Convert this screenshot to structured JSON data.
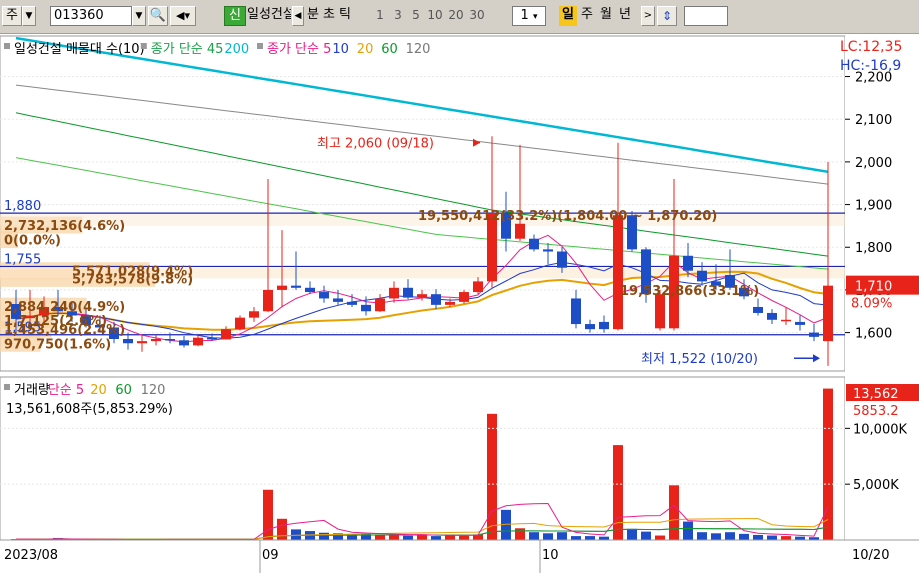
{
  "toolbar": {
    "market": "주",
    "code": "013360",
    "name_tab": "신",
    "name": "일성건설",
    "chart_types": [
      "분",
      "초",
      "틱"
    ],
    "intervals": [
      "1",
      "3",
      "5",
      "10",
      "20",
      "30"
    ],
    "interval_value": "1",
    "periods": [
      "일",
      "주",
      "월",
      "년"
    ],
    "active_period": "일"
  },
  "chart_data": [
    {
      "type": "candlestick",
      "title": "일성건설 매물대 수(10)",
      "legend": [
        {
          "text": "일성건설 매물대 수(10)",
          "color": "#000000"
        },
        {
          "text": "종가 단순 45",
          "color": "#1aa24a"
        },
        {
          "text": "200",
          "color": "#00b8d4"
        },
        {
          "text": "종가 단순 5",
          "color": "#e91e8c"
        },
        {
          "text": "10",
          "color": "#1e3cc8"
        },
        {
          "text": "20",
          "color": "#e6a100"
        },
        {
          "text": "60",
          "color": "#0a9a2a"
        },
        {
          "text": "120",
          "color": "#777777"
        }
      ],
      "y_ticks": [
        {
          "label": "2,200",
          "value": 2200
        },
        {
          "label": "2,100",
          "value": 2100
        },
        {
          "label": "2,000",
          "value": 2000
        },
        {
          "label": "1,900",
          "value": 1900
        },
        {
          "label": "1,800",
          "value": 1800
        },
        {
          "label": "1,700",
          "value": 1700
        },
        {
          "label": "1,600",
          "value": 1600
        }
      ],
      "ylim": [
        1510,
        2295
      ],
      "right_info": [
        "LC:12,35",
        "HC:-16,9"
      ],
      "last_price": {
        "label": "1,710",
        "value": 1710
      },
      "last_change": "8.09%",
      "annotations": {
        "high": "최고 2,060 (09/18)",
        "low": "최저 1,522 (10/20)",
        "range": "19,550,412(33.2%)(1,804.00 ~ 1,870.20)",
        "range2": "19,532,866(33.1%)"
      },
      "level_labels": [
        {
          "text": "1,880",
          "value": 1880,
          "color": "#1a3cc8"
        },
        {
          "text": "1,755",
          "value": 1755,
          "color": "#1a3cc8"
        },
        {
          "text": "1,595",
          "value": 1595,
          "color": "#1a3cc8"
        }
      ],
      "horizontal_lines": [
        1880,
        1755,
        1595
      ],
      "volume_profile": [
        {
          "label": "2,732,136(4.6%)",
          "price": 1852,
          "pct": 4.6
        },
        {
          "label": "0(0.0%)",
          "price": 1818,
          "pct": 0
        },
        {
          "label": "5,571,028(9.4%)",
          "price": 1745,
          "pct": 9.4
        },
        {
          "label": "5,783,578(9.8%)",
          "price": 1727,
          "pct": 9.8
        },
        {
          "label": "2,884,240(4.9%)",
          "price": 1662,
          "pct": 4.9
        },
        {
          "label": "1,7,125(2.6%)",
          "price": 1630,
          "pct": 2.6
        },
        {
          "label": "1,453,496(2.4%)",
          "price": 1608,
          "pct": 2.4
        },
        {
          "label": "970,750(1.6%)",
          "price": 1575,
          "pct": 1.6
        }
      ],
      "candles": [
        {
          "o": 1667,
          "h": 1700,
          "l": 1600,
          "c": 1632
        },
        {
          "o": 1634,
          "h": 1700,
          "l": 1605,
          "c": 1640
        },
        {
          "o": 1640,
          "h": 1685,
          "l": 1620,
          "c": 1660
        },
        {
          "o": 1660,
          "h": 1700,
          "l": 1638,
          "c": 1650
        },
        {
          "o": 1650,
          "h": 1670,
          "l": 1625,
          "c": 1640
        },
        {
          "o": 1640,
          "h": 1655,
          "l": 1612,
          "c": 1618
        },
        {
          "o": 1618,
          "h": 1640,
          "l": 1600,
          "c": 1612
        },
        {
          "o": 1612,
          "h": 1625,
          "l": 1575,
          "c": 1585
        },
        {
          "o": 1585,
          "h": 1600,
          "l": 1560,
          "c": 1575
        },
        {
          "o": 1575,
          "h": 1595,
          "l": 1555,
          "c": 1580
        },
        {
          "o": 1580,
          "h": 1595,
          "l": 1570,
          "c": 1585
        },
        {
          "o": 1585,
          "h": 1600,
          "l": 1575,
          "c": 1582
        },
        {
          "o": 1582,
          "h": 1592,
          "l": 1565,
          "c": 1570
        },
        {
          "o": 1570,
          "h": 1595,
          "l": 1568,
          "c": 1588
        },
        {
          "o": 1588,
          "h": 1598,
          "l": 1580,
          "c": 1584
        },
        {
          "o": 1584,
          "h": 1615,
          "l": 1584,
          "c": 1608
        },
        {
          "o": 1608,
          "h": 1640,
          "l": 1605,
          "c": 1635
        },
        {
          "o": 1635,
          "h": 1660,
          "l": 1625,
          "c": 1650
        },
        {
          "o": 1650,
          "h": 1960,
          "l": 1648,
          "c": 1700
        },
        {
          "o": 1700,
          "h": 1840,
          "l": 1660,
          "c": 1710
        },
        {
          "o": 1710,
          "h": 1790,
          "l": 1700,
          "c": 1705
        },
        {
          "o": 1705,
          "h": 1720,
          "l": 1690,
          "c": 1695
        },
        {
          "o": 1695,
          "h": 1710,
          "l": 1670,
          "c": 1680
        },
        {
          "o": 1680,
          "h": 1700,
          "l": 1665,
          "c": 1672
        },
        {
          "o": 1672,
          "h": 1690,
          "l": 1660,
          "c": 1665
        },
        {
          "o": 1665,
          "h": 1685,
          "l": 1640,
          "c": 1650
        },
        {
          "o": 1650,
          "h": 1690,
          "l": 1648,
          "c": 1680
        },
        {
          "o": 1680,
          "h": 1720,
          "l": 1670,
          "c": 1705
        },
        {
          "o": 1705,
          "h": 1725,
          "l": 1678,
          "c": 1682
        },
        {
          "o": 1682,
          "h": 1700,
          "l": 1675,
          "c": 1690
        },
        {
          "o": 1690,
          "h": 1702,
          "l": 1655,
          "c": 1665
        },
        {
          "o": 1665,
          "h": 1680,
          "l": 1660,
          "c": 1672
        },
        {
          "o": 1672,
          "h": 1700,
          "l": 1668,
          "c": 1695
        },
        {
          "o": 1695,
          "h": 1730,
          "l": 1690,
          "c": 1720
        },
        {
          "o": 1720,
          "h": 2060,
          "l": 1705,
          "c": 1880
        },
        {
          "o": 1880,
          "h": 1930,
          "l": 1790,
          "c": 1820
        },
        {
          "o": 1820,
          "h": 2040,
          "l": 1815,
          "c": 1855
        },
        {
          "o": 1820,
          "h": 1830,
          "l": 1790,
          "c": 1795
        },
        {
          "o": 1795,
          "h": 1810,
          "l": 1760,
          "c": 1790
        },
        {
          "o": 1790,
          "h": 1800,
          "l": 1740,
          "c": 1752
        },
        {
          "o": 1680,
          "h": 1700,
          "l": 1610,
          "c": 1620
        },
        {
          "o": 1620,
          "h": 1630,
          "l": 1600,
          "c": 1608
        },
        {
          "o": 1625,
          "h": 1640,
          "l": 1600,
          "c": 1608
        },
        {
          "o": 1608,
          "h": 2045,
          "l": 1605,
          "c": 1875
        },
        {
          "o": 1875,
          "h": 1885,
          "l": 1790,
          "c": 1795
        },
        {
          "o": 1795,
          "h": 1800,
          "l": 1670,
          "c": 1690
        },
        {
          "o": 1610,
          "h": 1700,
          "l": 1605,
          "c": 1690
        },
        {
          "o": 1610,
          "h": 1960,
          "l": 1605,
          "c": 1780
        },
        {
          "o": 1780,
          "h": 1810,
          "l": 1730,
          "c": 1745
        },
        {
          "o": 1745,
          "h": 1765,
          "l": 1710,
          "c": 1720
        },
        {
          "o": 1720,
          "h": 1760,
          "l": 1700,
          "c": 1710
        },
        {
          "o": 1735,
          "h": 1795,
          "l": 1700,
          "c": 1705
        },
        {
          "o": 1705,
          "h": 1725,
          "l": 1678,
          "c": 1685
        },
        {
          "o": 1660,
          "h": 1680,
          "l": 1640,
          "c": 1646
        },
        {
          "o": 1646,
          "h": 1655,
          "l": 1620,
          "c": 1630
        },
        {
          "o": 1630,
          "h": 1660,
          "l": 1618,
          "c": 1630
        },
        {
          "o": 1625,
          "h": 1640,
          "l": 1605,
          "c": 1618
        },
        {
          "o": 1600,
          "h": 1620,
          "l": 1580,
          "c": 1590
        },
        {
          "o": 1580,
          "h": 2000,
          "l": 1522,
          "c": 1710
        }
      ],
      "x_labels": [
        {
          "label": "2023/08",
          "index": 0
        },
        {
          "label": "09",
          "index": 18
        },
        {
          "label": "10",
          "index": 38
        },
        {
          "label": "10/20",
          "index": 58
        }
      ]
    },
    {
      "type": "bar",
      "title": "거래량",
      "legend": [
        {
          "text": "거래량",
          "color": "#000000"
        },
        {
          "text": "단순 5",
          "color": "#e91e8c"
        },
        {
          "text": "20",
          "color": "#e6a100"
        },
        {
          "text": "60",
          "color": "#0a9a2a"
        },
        {
          "text": "120",
          "color": "#777777"
        }
      ],
      "info": "13,561,608주(5,853.29%)",
      "y_ticks": [
        {
          "label": "10,000K",
          "value": 10000
        },
        {
          "label": "5,000K",
          "value": 5000
        }
      ],
      "ylim": [
        0,
        14600
      ],
      "last_volume": "13,562",
      "last_pct": "5853.2",
      "volumes": [
        80,
        80,
        60,
        180,
        60,
        40,
        40,
        60,
        40,
        50,
        40,
        60,
        70,
        40,
        40,
        50,
        60,
        60,
        4500,
        1900,
        950,
        800,
        650,
        600,
        500,
        600,
        500,
        450,
        380,
        500,
        350,
        450,
        380,
        500,
        11300,
        2700,
        1050,
        700,
        600,
        700,
        350,
        350,
        300,
        8500,
        1000,
        750,
        400,
        4900,
        1650,
        700,
        600,
        700,
        550,
        450,
        400,
        350,
        300,
        250,
        13562
      ]
    }
  ]
}
